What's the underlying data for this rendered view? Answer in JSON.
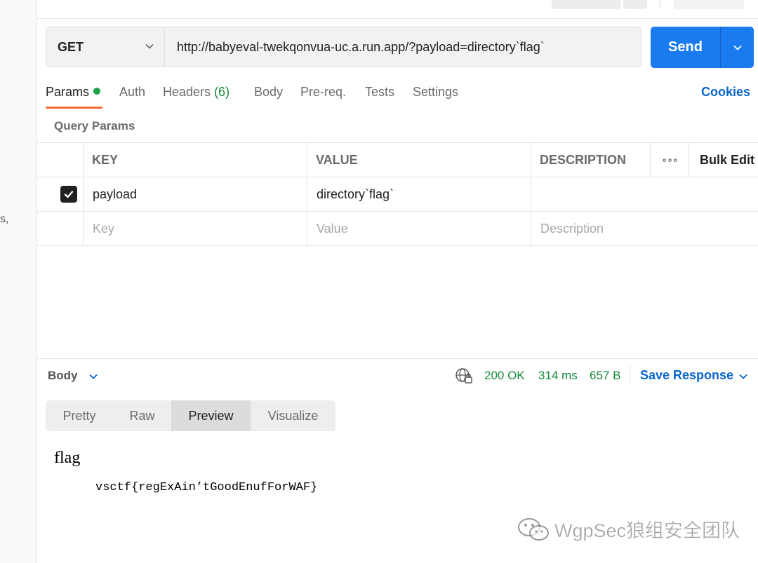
{
  "sidebar": {
    "fragment_text": "s,"
  },
  "request": {
    "method": "GET",
    "url": "http://babyeval-twekqonvua-uc.a.run.app/?payload=directory`flag`",
    "send_label": "Send"
  },
  "tabs": {
    "params": "Params",
    "auth": "Auth",
    "headers": "Headers",
    "headers_count": "(6)",
    "body": "Body",
    "prereq": "Pre-req.",
    "tests": "Tests",
    "settings": "Settings",
    "cookies": "Cookies"
  },
  "query_params": {
    "title": "Query Params",
    "columns": {
      "key": "KEY",
      "value": "VALUE",
      "description": "DESCRIPTION",
      "more": "∘∘∘",
      "bulk_edit": "Bulk Edit"
    },
    "rows": [
      {
        "checked": true,
        "key": "payload",
        "value": "directory`flag`",
        "description": ""
      }
    ],
    "placeholders": {
      "key": "Key",
      "value": "Value",
      "description": "Description"
    }
  },
  "response": {
    "body_label": "Body",
    "status": "200 OK",
    "time": "314 ms",
    "size": "657 B",
    "save_label": "Save Response",
    "view_tabs": [
      "Pretty",
      "Raw",
      "Preview",
      "Visualize"
    ],
    "active_view": "Preview",
    "preview": {
      "heading": "flag",
      "content": "vsctf{regExAin’tGoodEnufForWAF}"
    }
  },
  "watermark": {
    "text": "WgpSec狼组安全团队"
  },
  "colors": {
    "accent_blue": "#1a7af0",
    "link_blue": "#0a66c9",
    "success_green": "#168a3c",
    "tab_orange": "#f26b3a"
  }
}
